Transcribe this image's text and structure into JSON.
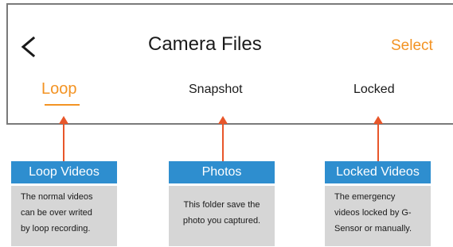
{
  "header": {
    "back_icon": "chevron-left-icon",
    "title": "Camera Files",
    "select_label": "Select",
    "accent_color": "#f39323"
  },
  "tabs": [
    {
      "label": "Loop",
      "active": true
    },
    {
      "label": "Snapshot",
      "active": false
    },
    {
      "label": "Locked",
      "active": false
    }
  ],
  "callouts": [
    {
      "heading": "Loop Videos",
      "description": "The normal videos\ncan be over writed\nby loop recording."
    },
    {
      "heading": "Photos",
      "description": "This folder save the\nphoto you captured."
    },
    {
      "heading": "Locked Videos",
      "description": "The emergency\nvideos locked by G-\nSensor or manually."
    }
  ],
  "colors": {
    "callout_header": "#2e8ecf",
    "callout_body": "#d6d6d6",
    "arrow": "#e8562a"
  }
}
